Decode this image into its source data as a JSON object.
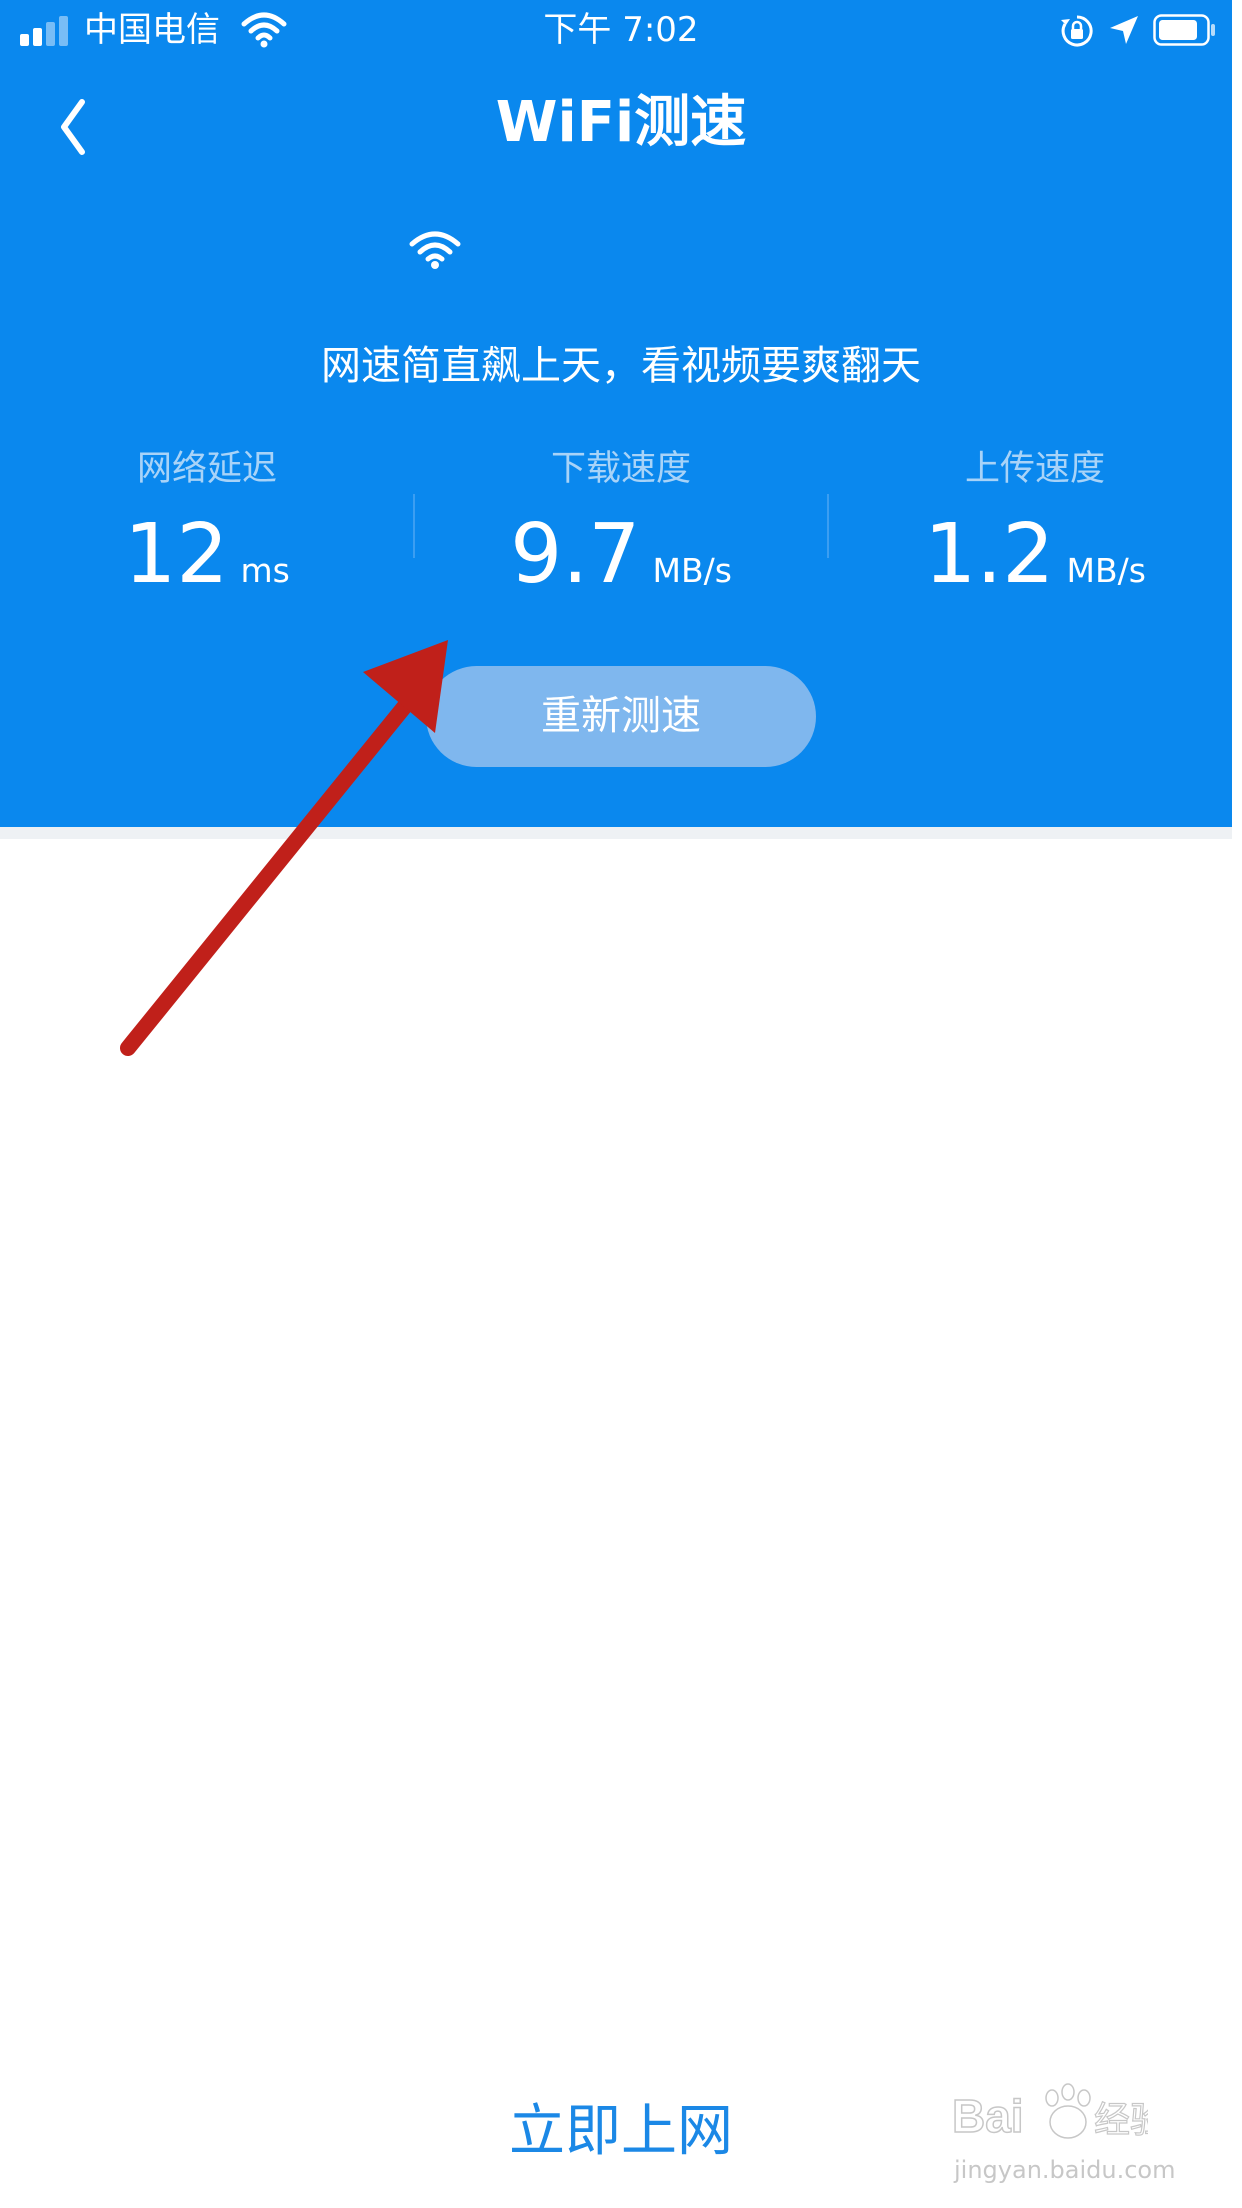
{
  "status_bar": {
    "carrier": "中国电信",
    "time": "下午 7:02"
  },
  "header": {
    "title": "WiFi测速",
    "tagline": "网速简直飙上天，看视频要爽翻天"
  },
  "stats": [
    {
      "label": "网络延迟",
      "value": "12",
      "unit": "ms"
    },
    {
      "label": "下载速度",
      "value": "9.7",
      "unit": "MB/s"
    },
    {
      "label": "上传速度",
      "value": "1.2",
      "unit": "MB/s"
    }
  ],
  "retest_button": "重新测速",
  "go_online_button": "立即上网",
  "watermark": {
    "url": "jingyan.baidu.com"
  },
  "colors": {
    "header_blue": "#0A88EE",
    "annotation_arrow": "#C0201A",
    "link_blue": "#1B88E6"
  },
  "icons": [
    "signal-icon",
    "wifi-icon",
    "lock-rotation-icon",
    "location-arrow-icon",
    "battery-icon",
    "back-chevron-icon",
    "wifi-large-icon"
  ]
}
